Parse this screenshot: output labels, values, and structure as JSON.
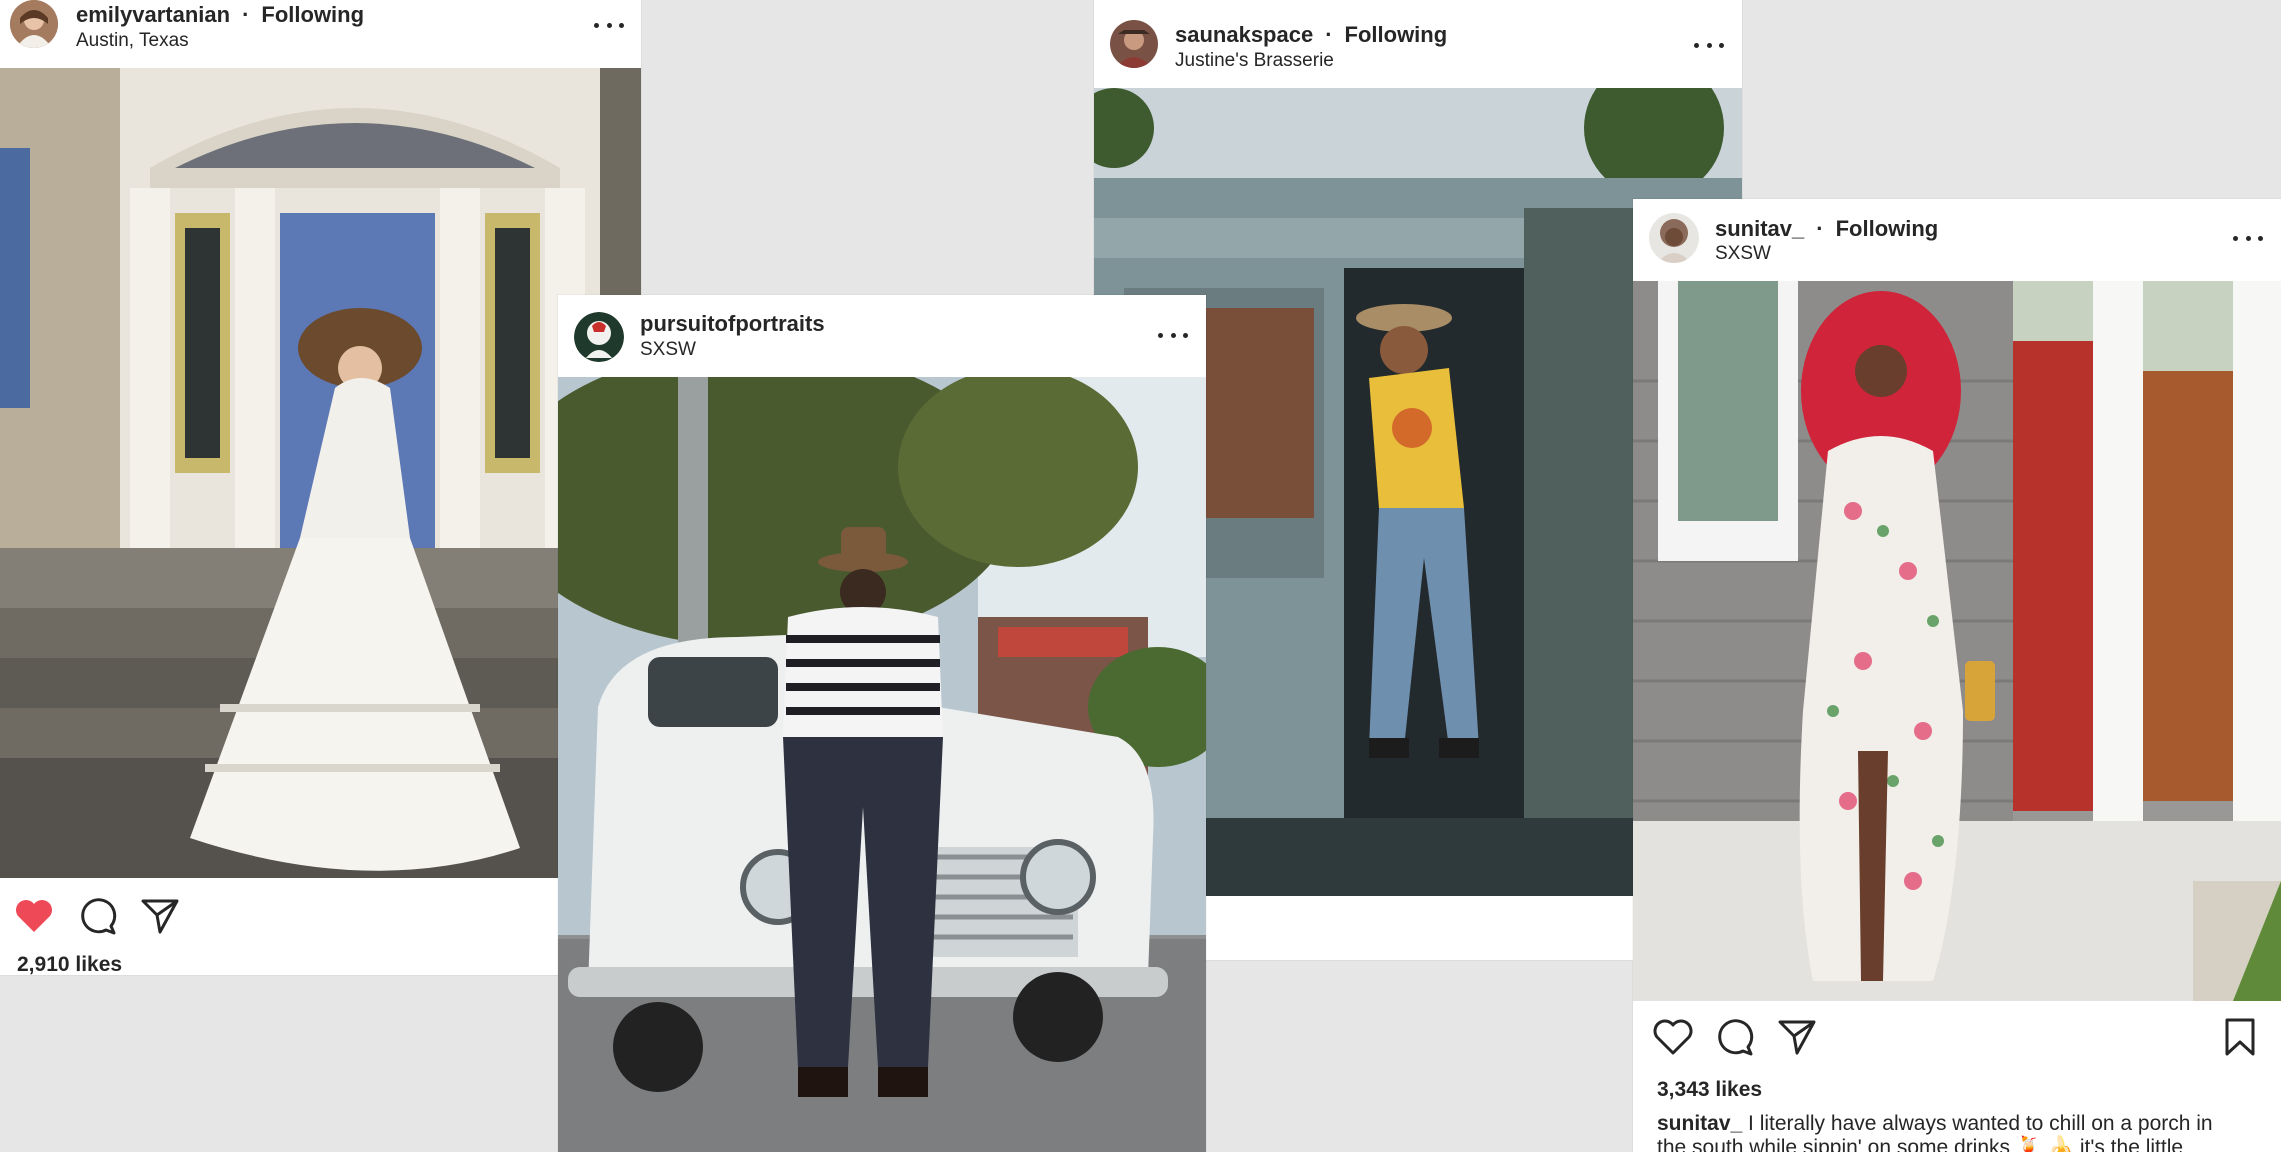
{
  "posts": [
    {
      "id": "emily",
      "username": "emilyvartanian",
      "follow_status": "Following",
      "location": "Austin, Texas",
      "liked": true,
      "likes": "2,910 likes"
    },
    {
      "id": "pursuit",
      "username": "pursuitofportraits",
      "location": "SXSW"
    },
    {
      "id": "saunak",
      "username": "saunakspace",
      "follow_status": "Following",
      "location": "Justine's Brasserie"
    },
    {
      "id": "sunita",
      "username": "sunitav_",
      "follow_status": "Following",
      "location": "SXSW",
      "liked": false,
      "likes": "3,343 likes",
      "caption_user": "sunitav_",
      "caption_text": " I literally have always wanted to chill on a porch in",
      "caption_text_2": "the south while sippin' on some drinks 🍹 🍌 it's the little"
    }
  ],
  "icons": {
    "more": "more-options-icon",
    "like": "heart-icon",
    "comment": "comment-icon",
    "share": "share-icon",
    "save": "bookmark-icon"
  },
  "colors": {
    "liked_heart": "#ed4956",
    "text": "#262626",
    "background": "#e6e6e6"
  }
}
